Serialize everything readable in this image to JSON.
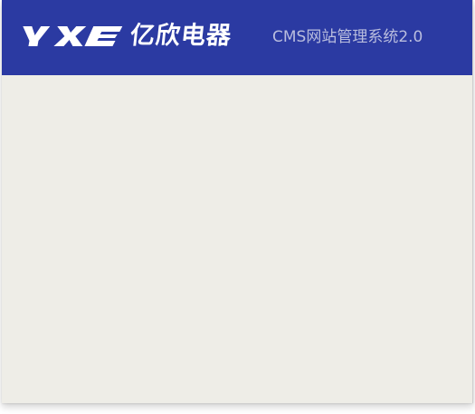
{
  "header": {
    "logo_text": "YXE",
    "brand_name": "亿欣电器",
    "system_title": "CMS网站管理系统2.0"
  },
  "colors": {
    "header_background": "#2b3aa2",
    "body_background": "#eeede7",
    "logo_color": "#ffffff",
    "subtitle_color": "#b9bdde"
  }
}
